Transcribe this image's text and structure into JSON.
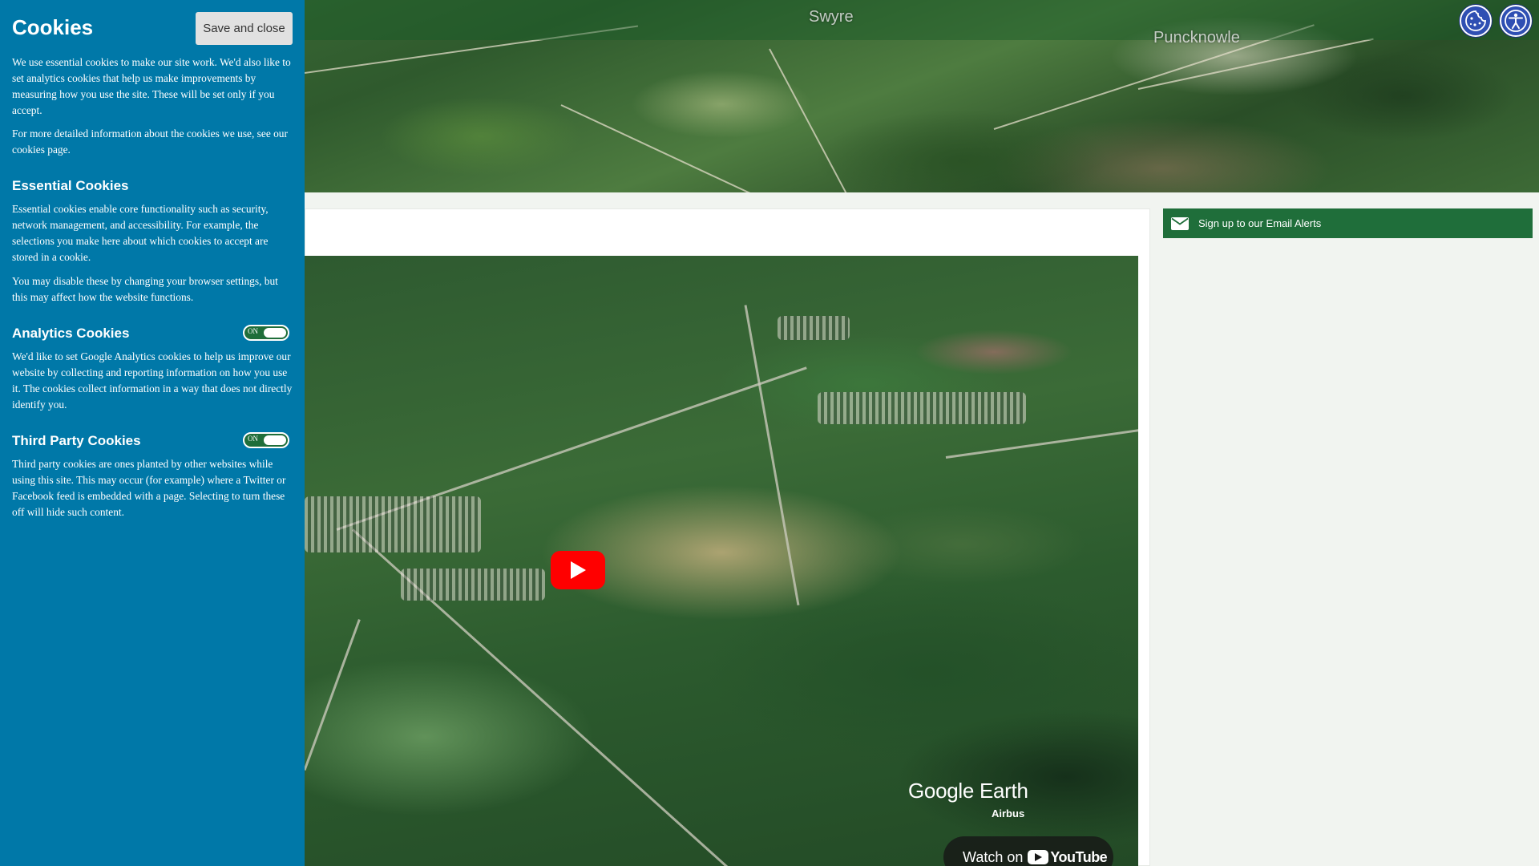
{
  "hero": {
    "labels": [
      "Swyre",
      "Puncknowle"
    ]
  },
  "top_icons": {
    "cookie_settings": "cookie-icon",
    "accessibility": "accessibility-icon"
  },
  "video": {
    "watermark": "Google Earth",
    "credit": "Airbus",
    "watch_on": "Watch on",
    "youtube": "YouTube"
  },
  "sidebar": {
    "email_alerts_label": "Sign up to our Email Alerts"
  },
  "cookies": {
    "title": "Cookies",
    "save_label": "Save and close",
    "intro_1": "We use essential cookies to make our site work. We'd also like to set analytics cookies that help us make improvements by measuring how you use the site. These will be set only if you accept.",
    "intro_2": "For more detailed information about the cookies we use, see our cookies page.",
    "essential": {
      "heading": "Essential Cookies",
      "text_1": "Essential cookies enable core functionality such as security, network management, and accessibility. For example, the selections you make here about which cookies to accept are stored in a cookie.",
      "text_2": "You may disable these by changing your browser settings, but this may affect how the website functions."
    },
    "analytics": {
      "heading": "Analytics Cookies",
      "toggle": "ON",
      "text": "We'd like to set Google Analytics cookies to help us improve our website by collecting and reporting information on how you use it. The cookies collect information in a way that does not directly identify you."
    },
    "third_party": {
      "heading": "Third Party Cookies",
      "toggle": "ON",
      "text": "Third party cookies are ones planted by other websites while using this site. This may occur (for example) where a Twitter or Facebook feed is embedded with a page. Selecting to turn these off will hide such content."
    }
  },
  "colors": {
    "cookie_panel": "#0078a8",
    "toggle_on": "#1f6e3a",
    "email_bar": "#1f6e3a",
    "icon_button": "#2f4fb3",
    "play_button": "#ff0000"
  }
}
